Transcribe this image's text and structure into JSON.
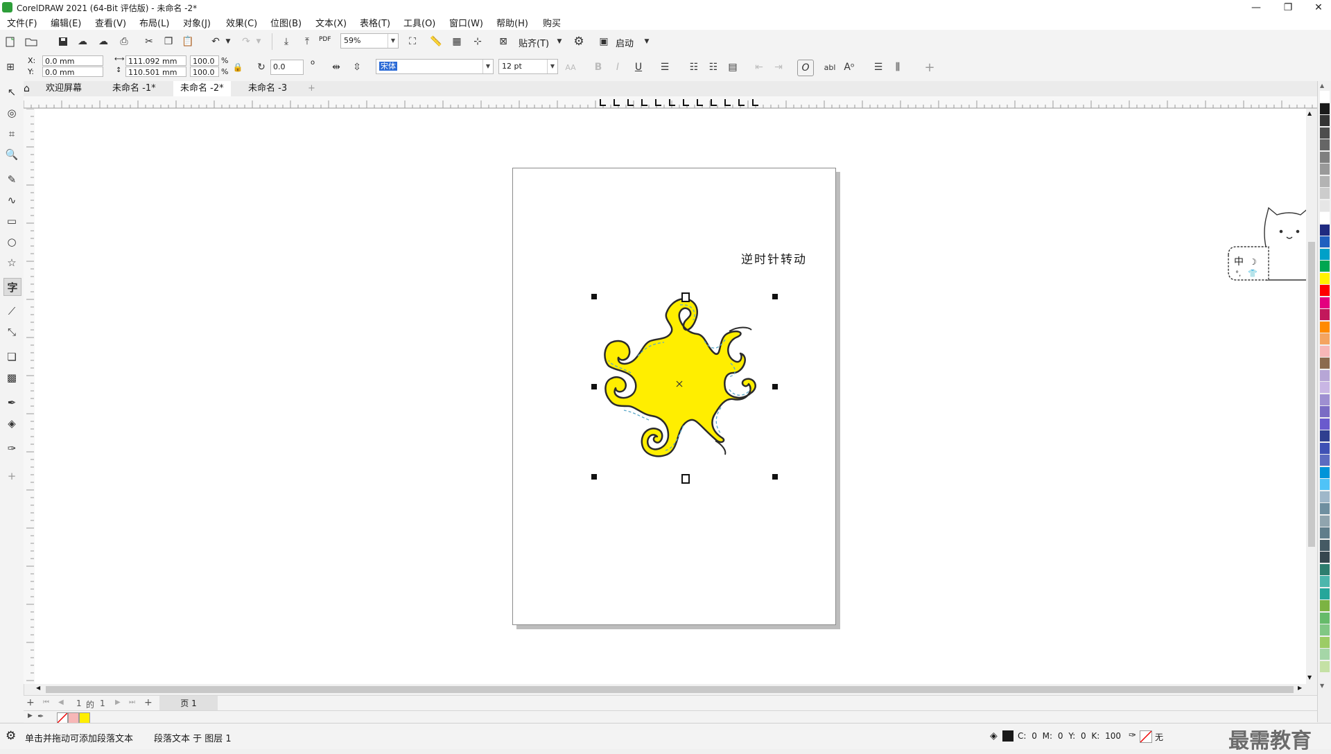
{
  "window": {
    "title": "CorelDRAW 2021 (64-Bit 评估版) - 未命名 -2*",
    "controls": {
      "minimize": "—",
      "restore": "❐",
      "close": "✕"
    }
  },
  "menu": [
    "文件(F)",
    "编辑(E)",
    "查看(V)",
    "布局(L)",
    "对象(J)",
    "效果(C)",
    "位图(B)",
    "文本(X)",
    "表格(T)",
    "工具(O)",
    "窗口(W)",
    "帮助(H)",
    "购买"
  ],
  "toolbar": {
    "zoom": "59%",
    "snap": "贴齐(T)",
    "launch": "启动",
    "pdf_label": "PDF"
  },
  "properties": {
    "x_label": "X:",
    "x": "0.0 mm",
    "y_label": "Y:",
    "y": "0.0 mm",
    "width": "111.092 mm",
    "height": "110.501 mm",
    "scale_w": "100.0",
    "scale_h": "100.0",
    "pct": "%",
    "rotation": "0.0",
    "deg": "o",
    "font": "宋体",
    "size": "12 pt",
    "bold": "B",
    "italic": "I",
    "underline": "U",
    "char_a": "abl"
  },
  "tabs": [
    "欢迎屏幕",
    "未命名 -1*",
    "未命名 -2*",
    "未命名 -3"
  ],
  "tab_add": "+",
  "document": {
    "text": "逆时针转动"
  },
  "pagenav": {
    "pos": "1",
    "of": "的",
    "total": "1",
    "page": "页 1"
  },
  "status": {
    "hint": "单击并拖动可添加段落文本",
    "layer": "段落文本 于 图层 1",
    "cmyk": "C: 0 M: 0 Y: 0 K: 100",
    "outline": "无"
  },
  "ime": {
    "label": "中"
  },
  "watermark": "最需教育",
  "colors": {
    "accent": "#2e9e3a",
    "fill": "#ffee00",
    "outline": "#2b2b2b",
    "selection": "#cde6ff"
  },
  "palette": [
    "#ffffff",
    "#1a1a1a",
    "#333333",
    "#4d4d4d",
    "#666666",
    "#808080",
    "#999999",
    "#b3b3b3",
    "#cccccc",
    "#e6e6e6",
    "#ffffff",
    "#1f2a80",
    "#1f5fbf",
    "#00a0c8",
    "#00a650",
    "#fff200",
    "#ff0000",
    "#e4007f",
    "#c2185b",
    "#ff8a00",
    "#f4a460",
    "#f7b7b7",
    "#8b6b4e",
    "#b7a6d6",
    "#c9b6e4",
    "#9e8fd1",
    "#7a6cc4",
    "#6a5acd",
    "#2f3f8f",
    "#3f51b5",
    "#5c6bc0",
    "#0094d9",
    "#4fc3f7",
    "#9fb7c9",
    "#6f8fa0",
    "#90a4ae",
    "#607d8b",
    "#455a64",
    "#37474f",
    "#2e7d6e",
    "#4db6ac",
    "#26a69a",
    "#7cb342",
    "#66bb6a",
    "#81c784",
    "#9ccc65",
    "#a5d6a7",
    "#c5e1a5"
  ]
}
